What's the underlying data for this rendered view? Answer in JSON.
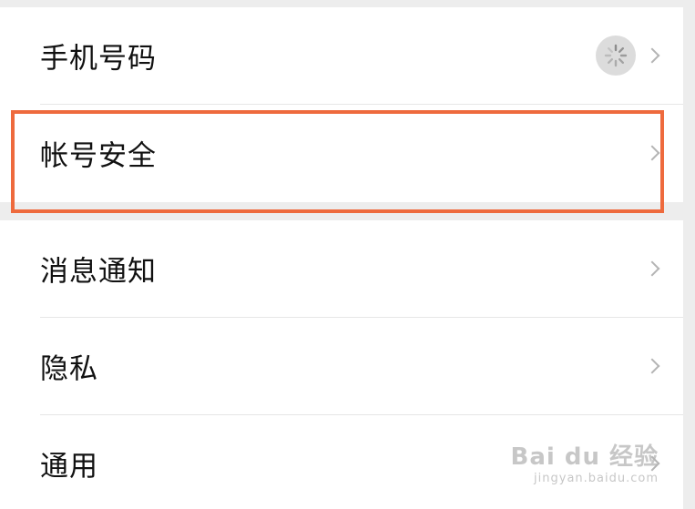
{
  "settings": {
    "items": [
      {
        "label": "手机号码"
      },
      {
        "label": "帐号安全"
      },
      {
        "label": "消息通知"
      },
      {
        "label": "隐私"
      },
      {
        "label": "通用"
      }
    ]
  },
  "watermark": {
    "main": "Bai du 经验",
    "sub": "jingyan.baidu.com"
  },
  "colors": {
    "highlight": "#ee6a3d",
    "background": "#ededed",
    "card": "#ffffff"
  }
}
